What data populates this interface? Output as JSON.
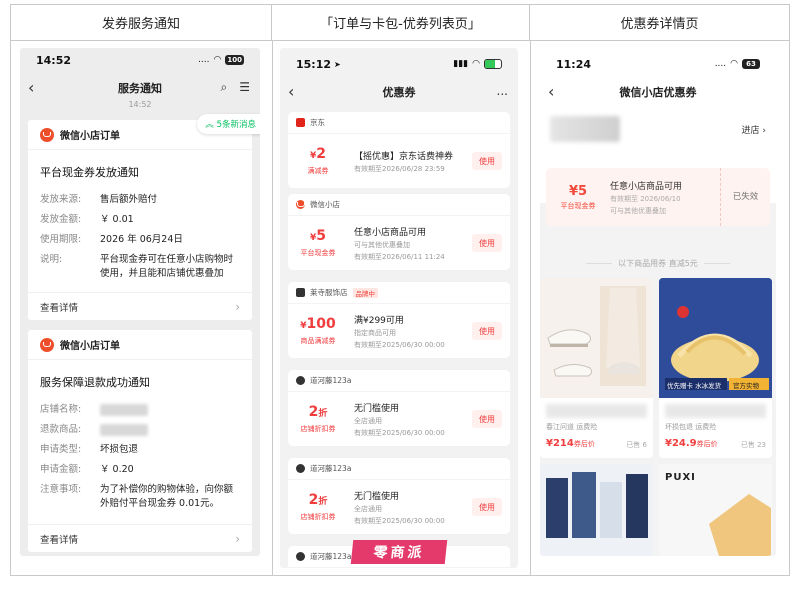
{
  "columns": [
    {
      "title": "发券服务通知"
    },
    {
      "title": "「订单与卡包-优券列表页」"
    },
    {
      "title": "优惠券详情页"
    }
  ],
  "phone1": {
    "time": "14:52",
    "signal": "....",
    "battery": "100",
    "nav_title": "服务通知",
    "timestamp": "14:52",
    "new_msg": "5条新消息",
    "card1": {
      "source": "微信小店订单",
      "title": "平台现金券发放通知",
      "rows": [
        {
          "k": "发放来源:",
          "v": "售后额外赔付"
        },
        {
          "k": "发放金额:",
          "v": "￥ 0.01"
        },
        {
          "k": "使用期限:",
          "v": "2026 年 06月24日"
        },
        {
          "k": "说明:",
          "v": "平台现金券可在任意小店购物时使用，并且能和店铺优惠叠加"
        }
      ],
      "detail": "查看详情"
    },
    "card2": {
      "source": "微信小店订单",
      "title": "服务保障退款成功通知",
      "rows": [
        {
          "k": "店铺名称:",
          "v": ""
        },
        {
          "k": "退款商品:",
          "v": ""
        },
        {
          "k": "申请类型:",
          "v": "坏损包退"
        },
        {
          "k": "申请金额:",
          "v": "￥ 0.20"
        },
        {
          "k": "注意事项:",
          "v": "为了补偿你的购物体验，向你额外赔付平台现金券 0.01元。"
        }
      ],
      "detail": "查看详情"
    }
  },
  "phone2": {
    "time": "15:12",
    "nav_title": "优惠券",
    "more": "...",
    "coupons": [
      {
        "shop": "京东",
        "amount": "2",
        "amount_type": "满减券",
        "name": "【摇优惠】京东话费神券",
        "d1": "有效期至2026/06/28 23:59",
        "d2": "",
        "btn": "使用",
        "tag": ""
      },
      {
        "shop": "微信小店",
        "amount": "5",
        "amount_type": "平台现金券",
        "name": "任意小店商品可用",
        "d1": "可与其他优惠叠加",
        "d2": "有效期至2026/06/11 11:24",
        "btn": "使用",
        "tag": ""
      },
      {
        "shop": "莱寺服饰店",
        "amount": "100",
        "amount_type": "商品满减券",
        "name": "满¥299可用",
        "d1": "指定商品可用",
        "d2": "有效期至2025/06/30 00:00",
        "btn": "使用",
        "tag": "品牌中"
      },
      {
        "shop": "道河藤123a",
        "amount": "2",
        "amount_type": "店铺折扣券",
        "name": "无门槛使用",
        "d1": "全店通用",
        "d2": "有效期至2025/06/30 00:00",
        "btn": "使用",
        "tag": ""
      },
      {
        "shop": "道河藤123a",
        "amount": "2",
        "amount_type": "店铺折扣券",
        "name": "无门槛使用",
        "d1": "全店通用",
        "d2": "有效期至2025/06/30 00:00",
        "btn": "使用",
        "tag": ""
      },
      {
        "shop": "道河藤123a",
        "amount": "",
        "amount_type": "",
        "name": "",
        "d1": "",
        "d2": "",
        "btn": "",
        "tag": ""
      }
    ],
    "watermark": "零商派"
  },
  "phone3": {
    "time": "11:24",
    "signal": "....",
    "battery": "63",
    "nav_title": "微信小店优惠券",
    "go_shop": "进店 ›",
    "coupon": {
      "amount": "5",
      "amount_type": "平台现金券",
      "name": "任意小店商品可用",
      "d1": "有效期至 2026/06/10",
      "d2": "可与其他优惠叠加",
      "status": "已失效"
    },
    "divider": "以下商品用券 直减5元",
    "products": [
      {
        "sub": "春江问道 运费险",
        "price": "214",
        "price_suffix": "券后价",
        "sold": "已售 6"
      },
      {
        "sub": "坏损包退 运费险",
        "price": "24.9",
        "price_suffix": "券后价",
        "sold": "已售 23",
        "badge1": "优先赠卡 水冰发货",
        "badge2": "官方实物"
      },
      {
        "sub": "",
        "price": "",
        "price_suffix": "",
        "sold": ""
      },
      {
        "brand": "PUXI",
        "sub": "",
        "price": "",
        "price_suffix": "",
        "sold": ""
      }
    ]
  }
}
